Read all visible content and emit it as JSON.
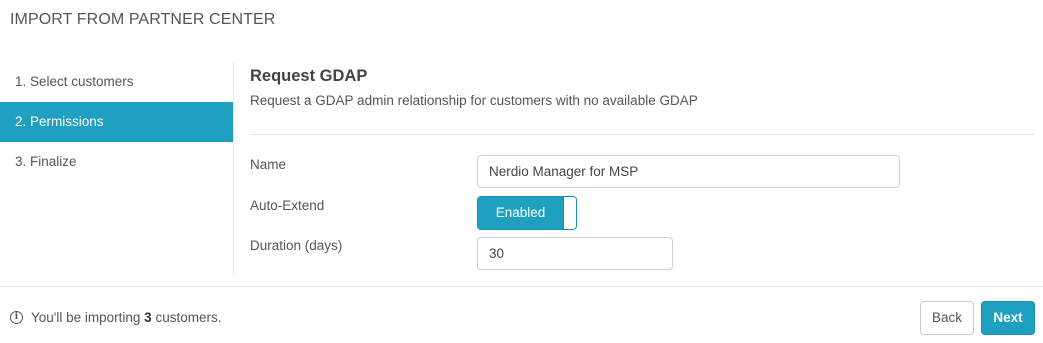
{
  "dialog": {
    "title": "IMPORT FROM PARTNER CENTER"
  },
  "steps": [
    {
      "label": "1. Select customers",
      "active": false
    },
    {
      "label": "2. Permissions",
      "active": true
    },
    {
      "label": "3. Finalize",
      "active": false
    }
  ],
  "section": {
    "heading": "Request GDAP",
    "subtitle": "Request a GDAP admin relationship for customers with no available GDAP"
  },
  "form": {
    "name_label": "Name",
    "name_value": "Nerdio Manager for MSP",
    "auto_extend_label": "Auto-Extend",
    "auto_extend_state": "Enabled",
    "duration_label": "Duration (days)",
    "duration_value": "30"
  },
  "footer": {
    "info_prefix": "You'll be importing",
    "customer_count": "3",
    "info_suffix": "customers.",
    "info_icon": "info-icon",
    "back_label": "Back",
    "next_label": "Next"
  },
  "colors": {
    "accent": "#1fa0c0",
    "border": "#e5e5e5"
  }
}
